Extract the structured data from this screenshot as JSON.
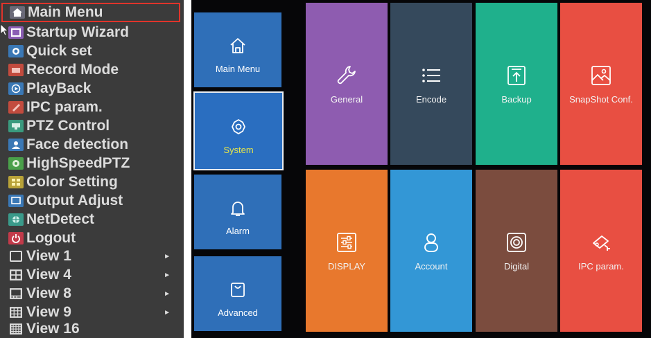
{
  "context_menu": {
    "items": [
      {
        "label": "Main Menu",
        "icon": "home-icon",
        "color": "#5a5a6a"
      },
      {
        "label": "Startup Wizard",
        "icon": "wizard-icon",
        "color": "#8b5fb4"
      },
      {
        "label": "Quick set",
        "icon": "quick-set-icon",
        "color": "#3a78b5"
      },
      {
        "label": "Record Mode",
        "icon": "record-icon",
        "color": "#c24b3e"
      },
      {
        "label": "PlayBack",
        "icon": "playback-icon",
        "color": "#3a78b5"
      },
      {
        "label": "IPC param.",
        "icon": "ipc-icon",
        "color": "#c24b3e"
      },
      {
        "label": "PTZ Control",
        "icon": "ptz-icon",
        "color": "#3a9a7e"
      },
      {
        "label": "Face detection",
        "icon": "face-icon",
        "color": "#3a78b5"
      },
      {
        "label": "HighSpeedPTZ",
        "icon": "highspeed-ptz-icon",
        "color": "#4aa04a"
      },
      {
        "label": "Color Setting",
        "icon": "color-setting-icon",
        "color": "#b8a238"
      },
      {
        "label": "Output Adjust",
        "icon": "output-adjust-icon",
        "color": "#3a78b5"
      },
      {
        "label": "NetDetect",
        "icon": "net-detect-icon",
        "color": "#3a9a8a"
      },
      {
        "label": "Logout",
        "icon": "power-icon",
        "color": "#c23a4a"
      },
      {
        "label": "View 1",
        "icon": "view1-icon",
        "submenu": true
      },
      {
        "label": "View 4",
        "icon": "view4-icon",
        "submenu": true
      },
      {
        "label": "View 8",
        "icon": "view8-icon",
        "submenu": true
      },
      {
        "label": "View 9",
        "icon": "view9-icon",
        "submenu": true
      },
      {
        "label": "View 16",
        "icon": "view16-icon",
        "submenu": false
      }
    ],
    "selected_index": 0,
    "submenu_arrow": "►"
  },
  "nav": [
    {
      "label": "Main Menu",
      "icon": "home-icon"
    },
    {
      "label": "System",
      "icon": "gear-icon",
      "active": true
    },
    {
      "label": "Alarm",
      "icon": "bell-icon"
    },
    {
      "label": "Advanced",
      "icon": "bag-icon"
    }
  ],
  "tiles": [
    {
      "label": "General",
      "icon": "wrench-icon",
      "color": "#8e5cb0"
    },
    {
      "label": "Encode",
      "icon": "list-icon",
      "color": "#35495c"
    },
    {
      "label": "Backup",
      "icon": "upload-box-icon",
      "color": "#1fb08c"
    },
    {
      "label": "SnapShot Conf.",
      "icon": "image-icon",
      "color": "#e84f42"
    },
    {
      "label": "DISPLAY",
      "icon": "sliders-icon",
      "color": "#e8782d"
    },
    {
      "label": "Account",
      "icon": "user-icon",
      "color": "#3397d6"
    },
    {
      "label": "Digital",
      "icon": "disk-icon",
      "color": "#7b4c3e"
    },
    {
      "label": "IPC param.",
      "icon": "camera-icon",
      "color": "#e84f42"
    }
  ]
}
